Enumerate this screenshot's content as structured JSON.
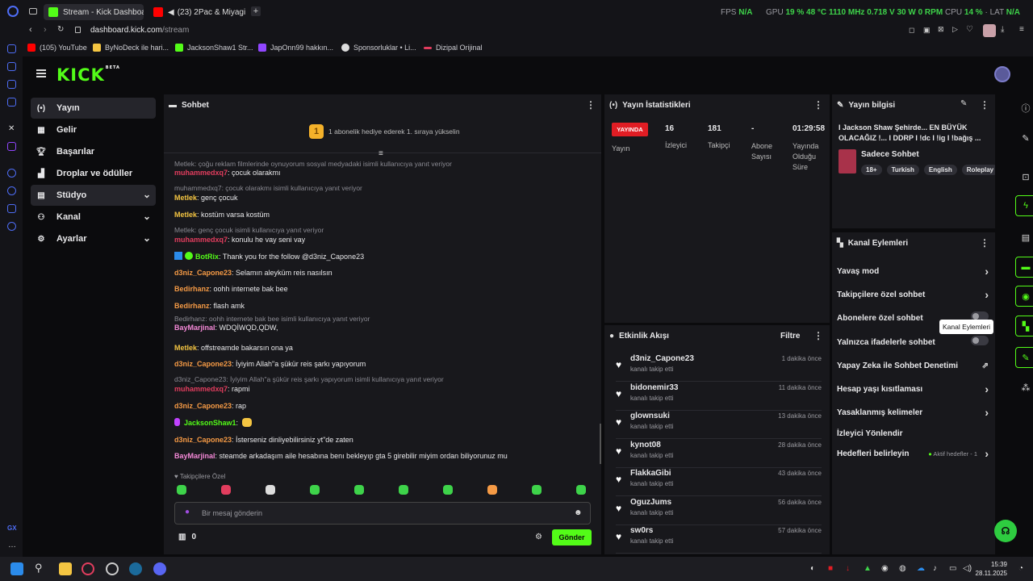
{
  "browser": {
    "tabs": [
      {
        "label": "Stream - Kick Dashboard",
        "color": "#53fc18"
      },
      {
        "label": "(23) 2Pac & Miyagi - O",
        "color": "#ff0000"
      }
    ],
    "new_tab": "+",
    "url_domain": "dashboard.kick.com",
    "url_path": "/stream",
    "hw": {
      "fps_label": "FPS",
      "fps_value": "N/A",
      "gpu_label": "GPU",
      "gpu_load": "19 %",
      "gpu_temp": "48 °C",
      "gpu_clock": "1110 MHz",
      "gpu_volt": "0.718 V",
      "gpu_power": "30 W",
      "gpu_fan": "0 RPM",
      "cpu_label": "CPU",
      "cpu_load": "14 %",
      "lat_label": "LAT",
      "lat_value": "N/A"
    },
    "bookmarks": [
      {
        "label": "(105) YouTube",
        "color": "#ff0000"
      },
      {
        "label": "ByNoDeck ile hari...",
        "color": "#f4c542"
      },
      {
        "label": "JacksonShaw1 Str...",
        "color": "#53fc18"
      },
      {
        "label": "JapOnn99 hakkın...",
        "color": "#9146ff"
      },
      {
        "label": "Sponsorluklar • Li...",
        "color": "#dddddd"
      },
      {
        "label": "Dizipal Orijinal",
        "color": "#e23d5e"
      }
    ]
  },
  "app": {
    "logo": "KICK",
    "logo_badge": "BETA",
    "nav": [
      {
        "label": "Yayın",
        "icon": "broadcast-icon"
      },
      {
        "label": "Gelir",
        "icon": "revenue-icon"
      },
      {
        "label": "Başarılar",
        "icon": "trophy-icon"
      },
      {
        "label": "Droplar ve ödüller",
        "icon": "gift-icon"
      },
      {
        "label": "Stüdyo",
        "icon": "studio-icon"
      },
      {
        "label": "Kanal",
        "icon": "channel-icon"
      },
      {
        "label": "Ayarlar",
        "icon": "gear-icon"
      }
    ],
    "chat": {
      "title": "Sohbet",
      "gift_rank": "1",
      "gift_text": "1 abonelik hediye ederek 1. sıraya yükselin",
      "messages": [
        {
          "reply": "Metlek: çoğu reklam filmlerinde oynuyorum sosyal medyadaki isimli kullanıcıya yanıt veriyor",
          "user": "muhammedxq7",
          "text": ": çocuk olarakmı"
        },
        {
          "reply": "muhammedxq7: çocuk olarakmı isimli kullanıcıya yanıt veriyor",
          "user": "Metlek",
          "text": ": genç çocuk"
        },
        {
          "user": "Metlek",
          "text": ": kostüm varsa kostüm"
        },
        {
          "reply": "Metlek: genç çocuk isimli kullanıcıya yanıt veriyor",
          "user": "muhammedxq7",
          "text": ": konulu he vay seni vay"
        },
        {
          "user": "BotRix",
          "text": ": Thank you for the follow @d3niz_Capone23"
        },
        {
          "user": "d3niz_Capone23",
          "text": ": Selamın aleyküm reis nasılsın"
        },
        {
          "user": "Bedirhanz",
          "text": ": oohh internete bak bee"
        },
        {
          "user": "Bedirhanz",
          "text": ": flash amk"
        },
        {
          "reply": "Bedirhanz: oohh internete bak bee isimli kullanıcıya yanıt veriyor",
          "user": "BayMarjinal",
          "text": ": WDQİWQD,QDW,"
        },
        {
          "user": "Metlek",
          "text": ": offstreamde bakarsın ona ya"
        },
        {
          "user": "d3niz_Capone23",
          "text": ": İyiyim Allah\"a şükür reis şarkı yapıyorum"
        },
        {
          "reply": "d3niz_Capone23: İyiyim Allah\"a şükür reis şarkı yapıyorum isimli kullanıcıya yanıt veriyor",
          "user": "muhammedxq7",
          "text": ": rapmi"
        },
        {
          "user": "d3niz_Capone23",
          "text": ": rap"
        },
        {
          "user": "JacksonShaw1",
          "text": ":"
        },
        {
          "user": "d3niz_Capone23",
          "text": ": İsterseniz dinliyebilirsiniz yt\"de zaten"
        },
        {
          "user": "BayMarjinal",
          "text": ": steamde arkadaşım aile hesabına benı bekleyıp gta 5 girebilir miyim ordan biliyorunuz mu"
        }
      ],
      "followers_only": "Takipçilere Özel",
      "input_placeholder": "Bir mesaj gönderin",
      "points": "0",
      "send": "Gönder"
    },
    "stats": {
      "title": "Yayın İstatistikleri",
      "live_badge": "YAYINDA",
      "live_label": "Yayın",
      "viewers_value": "16",
      "viewers_label": "İzleyici",
      "followers_value": "181",
      "followers_label": "Takipçi",
      "subs_value": "-",
      "subs_label": "Abone Sayısı",
      "uptime_value": "01:29:58",
      "uptime_label": "Yayında Olduğu Süre"
    },
    "activity": {
      "title": "Etkinlik Akışı",
      "filter": "Filtre",
      "items": [
        {
          "name": "d3niz_Capone23",
          "sub": "kanalı takip etti",
          "time": "1 dakika önce"
        },
        {
          "name": "bidonemir33",
          "sub": "kanalı takip etti",
          "time": "11 dakika önce"
        },
        {
          "name": "glownsuki",
          "sub": "kanalı takip etti",
          "time": "13 dakika önce"
        },
        {
          "name": "kynot08",
          "sub": "kanalı takip etti",
          "time": "28 dakika önce"
        },
        {
          "name": "FlakkaGibi",
          "sub": "kanalı takip etti",
          "time": "43 dakika önce"
        },
        {
          "name": "OguzJums",
          "sub": "kanalı takip etti",
          "time": "56 dakika önce"
        },
        {
          "name": "sw0rs",
          "sub": "kanalı takip etti",
          "time": "57 dakika önce"
        }
      ]
    },
    "info": {
      "title": "Yayın bilgisi",
      "stream_title": "I Jackson Shaw Şehirde... EN BÜYÜK OLACAĞIZ !... I DDRP I !dc I !ig I !bağış ...",
      "category": "Sadece Sohbet",
      "tags": [
        "18+",
        "Turkish",
        "English",
        "Roleplay"
      ]
    },
    "channel_actions": {
      "title": "Kanal Eylemleri",
      "items": [
        {
          "label": "Yavaş mod",
          "type": "arrow"
        },
        {
          "label": "Takipçilere özel sohbet",
          "type": "arrow"
        },
        {
          "label": "Abonelere özel sohbet",
          "type": "toggle"
        },
        {
          "label": "Yalnızca ifadelerle sohbet",
          "type": "toggle"
        },
        {
          "label": "Yapay Zeka ile Sohbet Denetimi",
          "type": "external"
        },
        {
          "label": "Hesap yaşı kısıtlaması",
          "type": "arrow"
        },
        {
          "label": "Yasaklanmış kelimeler",
          "type": "arrow"
        },
        {
          "label": "İzleyici Yönlendir",
          "type": "none"
        },
        {
          "label": "Hedefleri belirleyin",
          "type": "arrow"
        }
      ],
      "goals_status": "Aktif hedefler - 1",
      "tooltip": "Kanal Eylemleri"
    }
  },
  "taskbar": {
    "time": "15:39",
    "date": "28.11.2025"
  }
}
